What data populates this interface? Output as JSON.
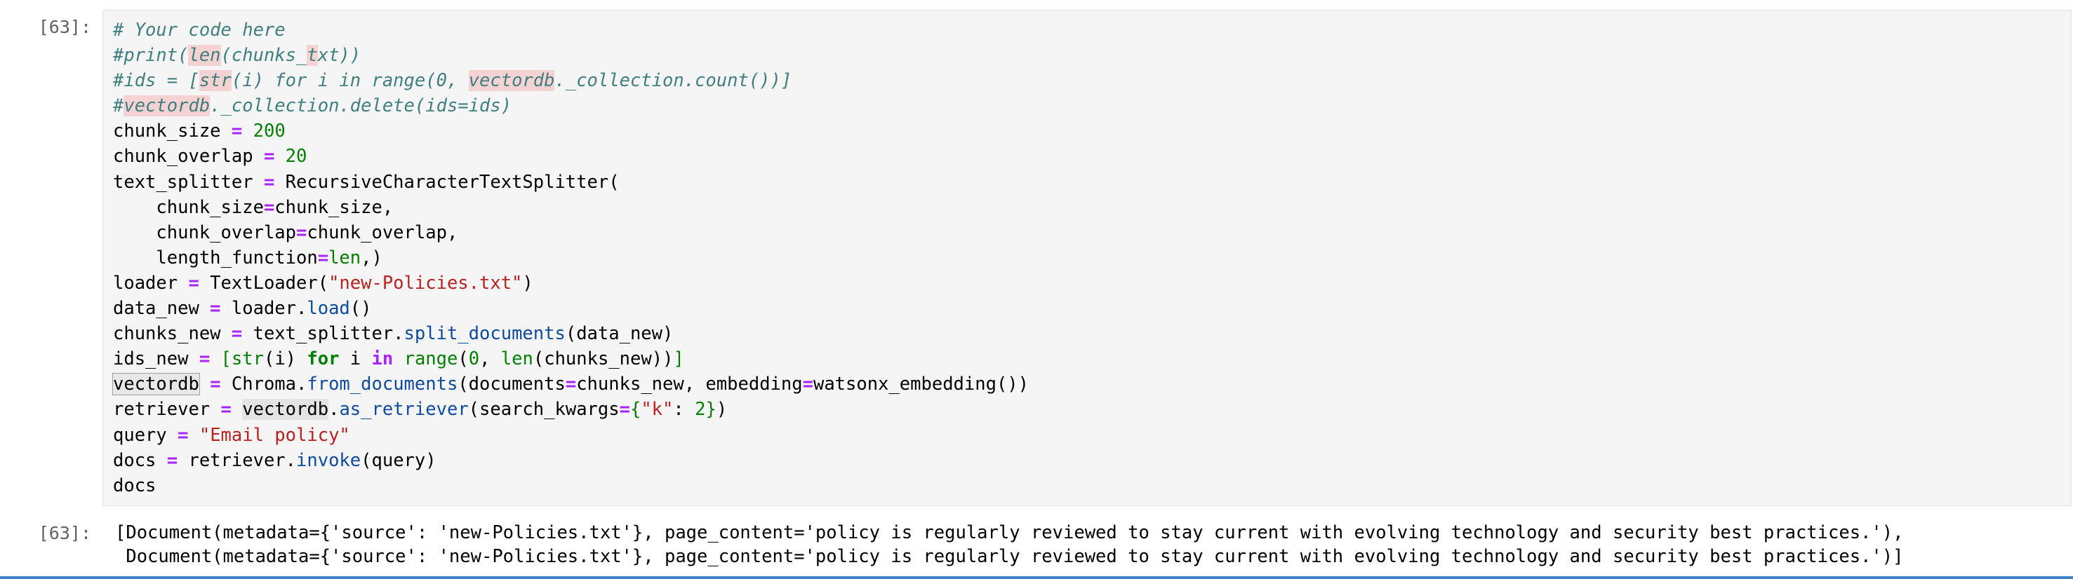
{
  "input_cell": {
    "prompt": "[63]:",
    "code_lines": [
      "# Your code here",
      "#print(len(chunks_txt))",
      "#ids = [str(i) for i in range(0, vectordb._collection.count())]",
      "#vectordb._collection.delete(ids=ids)",
      "chunk_size = 200",
      "chunk_overlap = 20",
      "text_splitter = RecursiveCharacterTextSplitter(",
      "    chunk_size=chunk_size,",
      "    chunk_overlap=chunk_overlap,",
      "    length_function=len,)",
      "loader = TextLoader(\"new-Policies.txt\")",
      "data_new = loader.load()",
      "chunks_new = text_splitter.split_documents(data_new)",
      "ids_new = [str(i) for i in range(0, len(chunks_new))]",
      "vectordb = Chroma.from_documents(documents=chunks_new, embedding=watsonx_embedding())",
      "retriever = vectordb.as_retriever(search_kwargs={\"k\": 2})",
      "query = \"Email policy\"",
      "docs = retriever.invoke(query)",
      "docs"
    ]
  },
  "output_cell": {
    "prompt": "[63]:",
    "lines": [
      "[Document(metadata={'source': 'new-Policies.txt'}, page_content='policy is regularly reviewed to stay current with evolving technology and security best practices.'),",
      " Document(metadata={'source': 'new-Policies.txt'}, page_content='policy is regularly reviewed to stay current with evolving technology and security best practices.')]"
    ]
  },
  "colors": {
    "comment": "#3f7f7f",
    "keyword": "#008000",
    "operator": "#aa22ff",
    "string": "#ba2121",
    "method": "#0c4b9e",
    "cell_background": "#f5f5f5",
    "prompt": "#616161",
    "active_border": "#3b82c4"
  }
}
